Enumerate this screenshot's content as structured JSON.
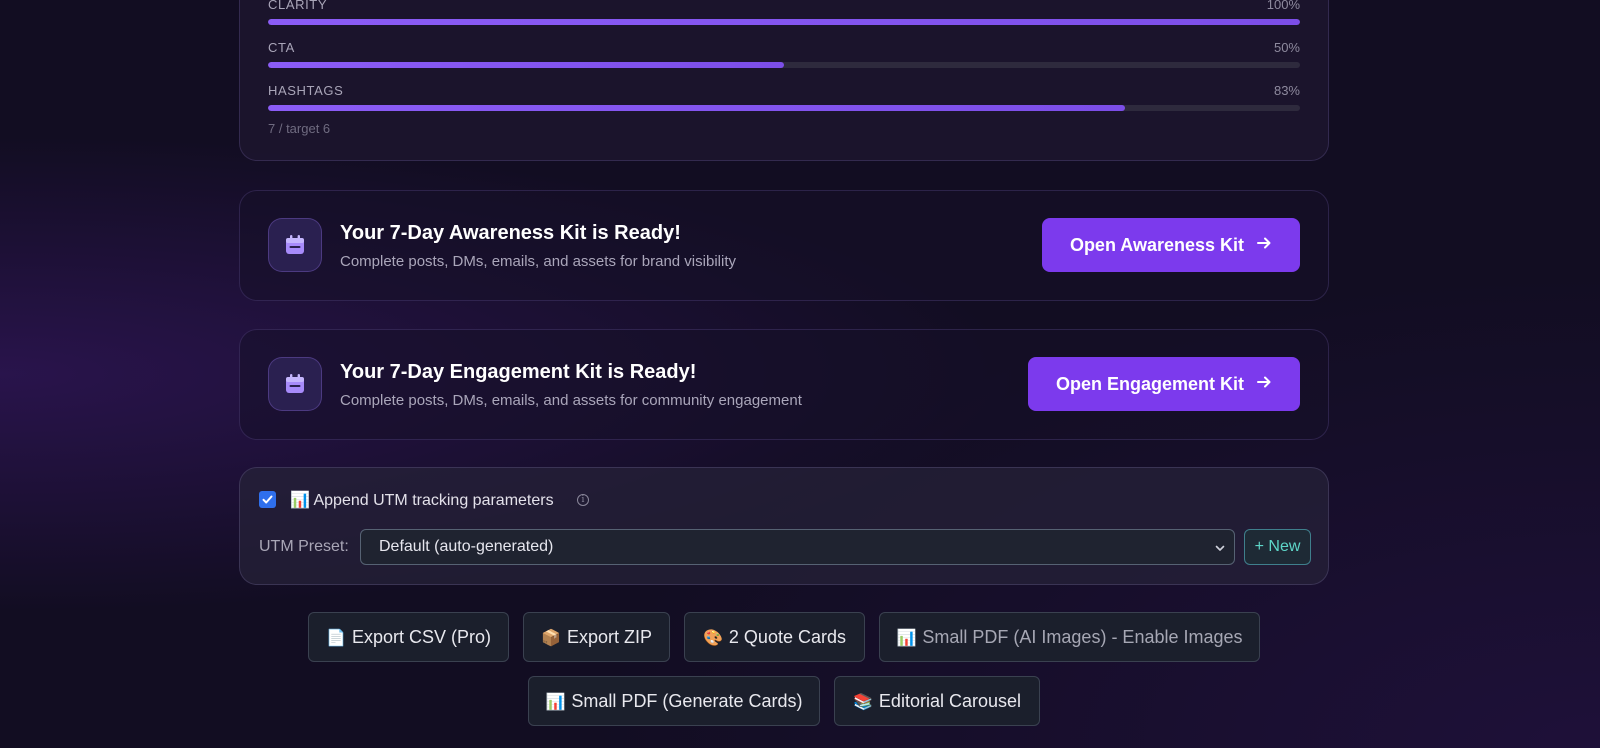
{
  "score": {
    "metrics": [
      {
        "label": "CLARITY",
        "percent_text": "100%",
        "value": 100
      },
      {
        "label": "CTA",
        "percent_text": "50%",
        "value": 50
      },
      {
        "label": "HASHTAGS",
        "percent_text": "83%",
        "value": 83
      }
    ],
    "hashtags_note": "7 / target 6",
    "bar_color": "#8b5cf6"
  },
  "kits": [
    {
      "icon": "calendar-icon",
      "title": "Your 7-Day Awareness Kit is Ready!",
      "subtitle": "Complete posts, DMs, emails, and assets for brand visibility",
      "button_label": "Open Awareness Kit"
    },
    {
      "icon": "calendar-icon",
      "title": "Your 7-Day Engagement Kit is Ready!",
      "subtitle": "Complete posts, DMs, emails, and assets for community engagement",
      "button_label": "Open Engagement Kit"
    }
  ],
  "utm": {
    "checked": true,
    "emoji": "📊",
    "label": "Append UTM tracking parameters",
    "preset_label": "UTM Preset:",
    "preset_value": "Default (auto-generated)",
    "new_label": "+ New"
  },
  "exports": {
    "row1": [
      {
        "emoji": "📄",
        "label": "Export CSV (Pro)"
      },
      {
        "emoji": "📦",
        "label": "Export ZIP"
      },
      {
        "emoji": "🎨",
        "label": "2 Quote Cards"
      },
      {
        "emoji": "📊",
        "label": "Small PDF (AI Images) - Enable Images"
      }
    ],
    "row2": [
      {
        "emoji": "📊",
        "label": "Small PDF (Generate Cards)"
      },
      {
        "emoji": "📚",
        "label": "Editorial Carousel"
      }
    ]
  },
  "colors": {
    "accent": "#7c3aed",
    "checkbox": "#2f6fec",
    "new_button_text": "#5ed6c8"
  }
}
